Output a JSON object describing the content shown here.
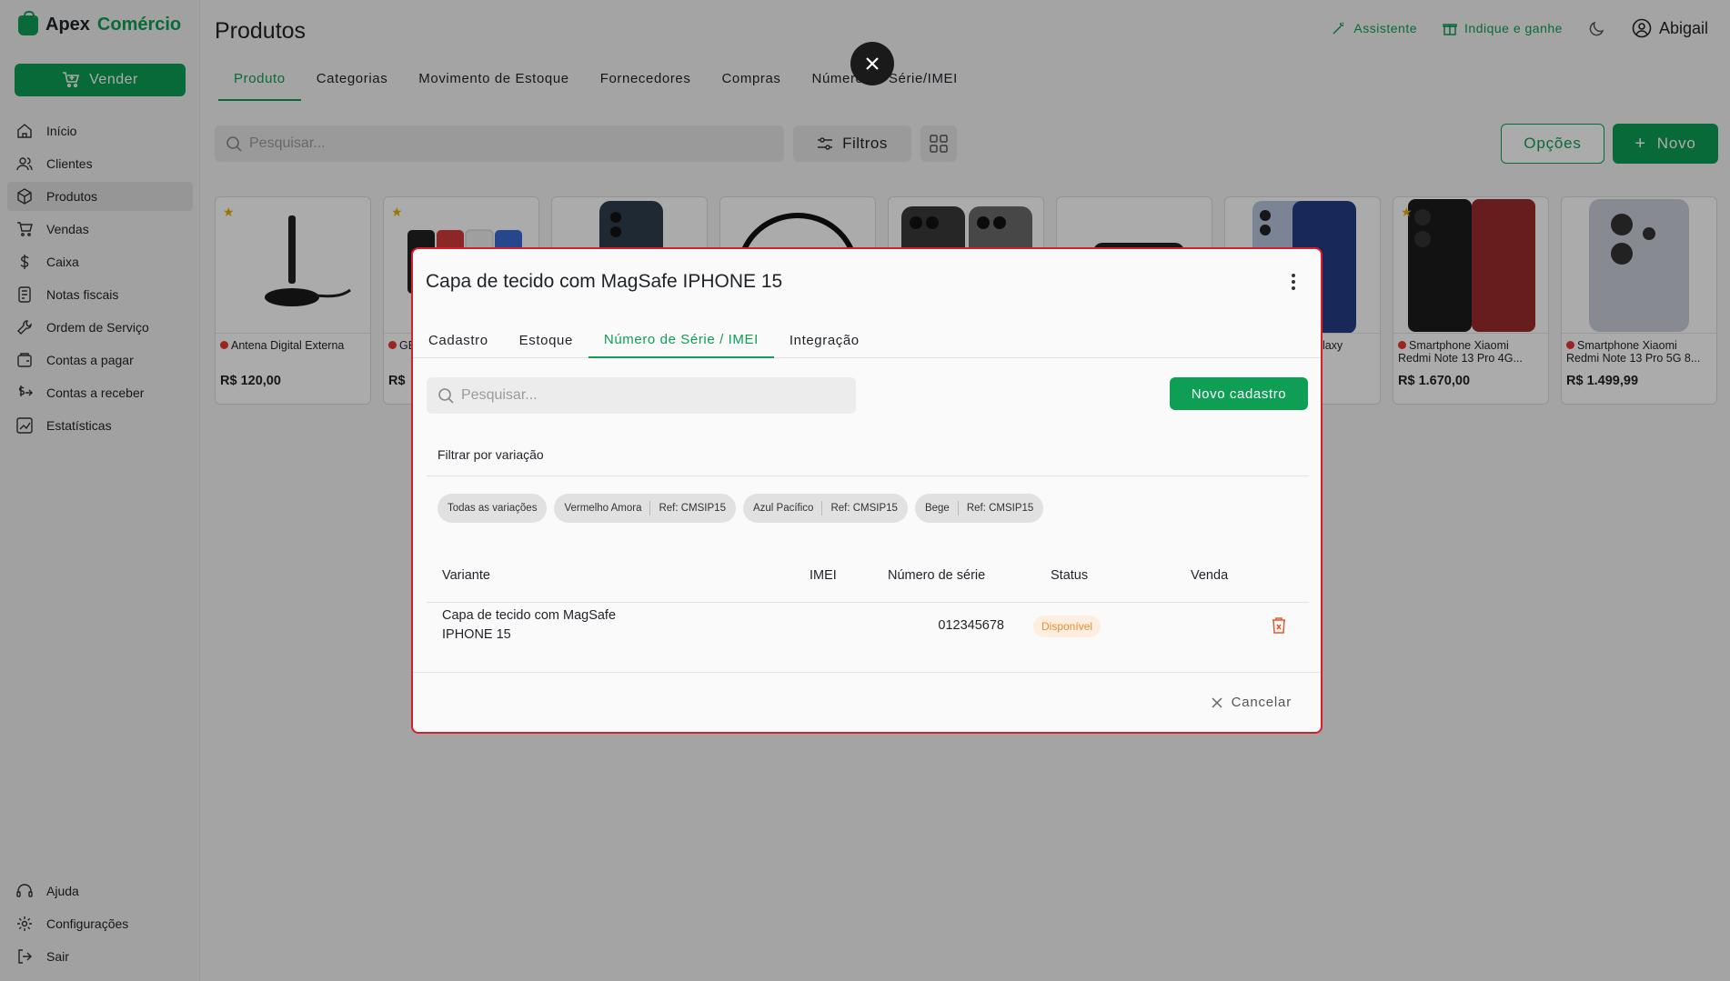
{
  "brand": {
    "name_part1": "Apex",
    "name_part2": "Comércio"
  },
  "sidebar": {
    "sell_label": "Vender",
    "items": [
      {
        "label": "Início",
        "icon": "home-icon"
      },
      {
        "label": "Clientes",
        "icon": "users-icon"
      },
      {
        "label": "Produtos",
        "icon": "box-icon",
        "active": true
      },
      {
        "label": "Vendas",
        "icon": "cart-icon"
      },
      {
        "label": "Caixa",
        "icon": "dollar-icon"
      },
      {
        "label": "Notas fiscais",
        "icon": "invoice-icon"
      },
      {
        "label": "Ordem de Serviço",
        "icon": "wrench-icon"
      },
      {
        "label": "Contas a pagar",
        "icon": "wallet-icon"
      },
      {
        "label": "Contas a receber",
        "icon": "receive-icon"
      },
      {
        "label": "Estatísticas",
        "icon": "chart-icon"
      }
    ],
    "bottom_items": [
      {
        "label": "Ajuda",
        "icon": "headset-icon"
      },
      {
        "label": "Configurações",
        "icon": "gear-icon"
      },
      {
        "label": "Sair",
        "icon": "logout-icon"
      }
    ]
  },
  "header": {
    "title": "Produtos",
    "assistente": "Assistente",
    "indique": "Indique e ganhe",
    "user": "Abigail"
  },
  "tabs": [
    "Produto",
    "Categorias",
    "Movimento de Estoque",
    "Fornecedores",
    "Compras",
    "Número de Série/IMEI"
  ],
  "toolbar": {
    "search_placeholder": "Pesquisar...",
    "filters": "Filtros",
    "opcoes": "Opções",
    "novo": "Novo"
  },
  "products": [
    {
      "name": "Antena Digital Externa",
      "price": "R$ 120,00",
      "starred": true
    },
    {
      "name": "GB)",
      "price": "R$ ",
      "starred": true
    },
    {
      "name": "",
      "price": "",
      "starred": false
    },
    {
      "name": "",
      "price": "",
      "starred": false
    },
    {
      "name": "",
      "price": "",
      "starred": false
    },
    {
      "name": "",
      "price": "",
      "starred": false
    },
    {
      "name": "alaxy",
      "price": "",
      "starred": false
    },
    {
      "name": "Smartphone Xiaomi Redmi Note 13 Pro 4G...",
      "price": "R$ 1.670,00",
      "starred": true
    },
    {
      "name": "Smartphone Xiaomi Redmi Note 13 Pro 5G 8...",
      "price": "R$ 1.499,99",
      "starred": false
    }
  ],
  "modal": {
    "title": "Capa de tecido com MagSafe IPHONE 15",
    "tabs": [
      "Cadastro",
      "Estoque",
      "Número de Série / IMEI",
      "Integração"
    ],
    "active_tab": 2,
    "search_placeholder": "Pesquisar...",
    "new_button": "Novo cadastro",
    "filter_label": "Filtrar por variação",
    "chips": [
      {
        "label": "Todas as variações",
        "ref": ""
      },
      {
        "label": "Vermelho Amora",
        "ref": "Ref: CMSIP15"
      },
      {
        "label": "Azul Pacífico",
        "ref": "Ref: CMSIP15"
      },
      {
        "label": "Bege",
        "ref": "Ref: CMSIP15"
      }
    ],
    "table": {
      "headers": [
        "Variante",
        "IMEI",
        "Número de série",
        "Status",
        "Venda"
      ],
      "rows": [
        {
          "variante_line1": "Capa de tecido com MagSafe",
          "variante_line2": "IPHONE 15",
          "imei": "",
          "serial": "012345678",
          "status": "Disponível",
          "venda": ""
        }
      ]
    },
    "cancel": "Cancelar"
  },
  "colors": {
    "accent": "#0e9f55",
    "danger": "#d81e2a",
    "status_available": "#f08a2c"
  }
}
